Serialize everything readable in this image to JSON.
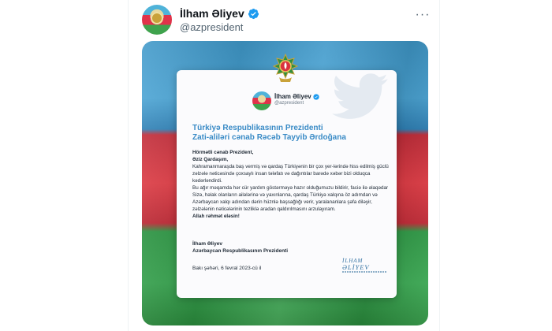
{
  "tweet": {
    "author_name": "İlham Əliyev",
    "handle": "@azpresident",
    "more_icon": "more-horizontal-icon",
    "verified_icon": "verified-badge-icon"
  },
  "letter": {
    "author_name": "İlham Əliyev",
    "handle": "@azpresident",
    "recipient_line1": "Türkiyə Respublikasının Prezidenti",
    "recipient_line2": "Zati-aliləri cənab Rəcəb Tayyib Ərdoğana",
    "salutation1": "Hörmətli cənab Prezident,",
    "salutation2": "Əziz Qardaşım,",
    "para1": "Kahramanmaraşda baş vermiş və qardaş Türkiyənin bir çox yer-lərində hiss edilmiş güclü zəlzələ nəticəsində çoxsaylı insan tələfatı və dağıntılar barədə xəbər bizi olduqca kədərləndirdi.",
    "para2": "Bu ağır məqamda hər cür yardım göstərməyə hazır olduğumuzu bildirir, faciə ilə əlaqədar Sizə, həlak olanların ailələrinə və yaxınlarına, qardaş Türkiyə xalqına öz adımdan və Azərbaycan xalqı adından dərin hüznlə başsağlığı verir, yaralananlara şəfa diləyir, zəlzələnin nəticələrinin tezliklə aradan qaldırılmasını arzulayıram.",
    "closing": "Allah rəhmət eləsin!",
    "signature_name": "İlham Əliyev",
    "signature_title": "Azərbaycan Respublikasının Prezidenti",
    "date": "Bakı şəhəri, 6 fevral 2023-cü il",
    "logo_line1": "İLHAM",
    "logo_line2": "ƏLİYEV"
  },
  "colors": {
    "flag_blue": "#3f98c9",
    "flag_red": "#e23c45",
    "flag_green": "#3aa852",
    "recipient_blue": "#3a8bc6",
    "verified_blue": "#1d9bf0"
  }
}
